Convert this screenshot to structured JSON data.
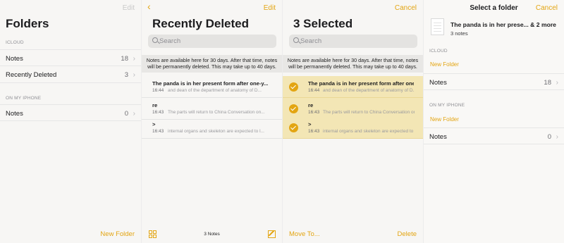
{
  "colors": {
    "accent": "#e3a512",
    "selected_row": "#f3e6b5",
    "background": "#f7f6f4"
  },
  "folders_panel": {
    "edit_label": "Edit",
    "title": "Folders",
    "icloud_header": "ICLOUD",
    "icloud_items": [
      {
        "label": "Notes",
        "count": "18"
      },
      {
        "label": "Recently Deleted",
        "count": "3"
      }
    ],
    "iphone_header": "ON MY IPHONE",
    "iphone_items": [
      {
        "label": "Notes",
        "count": "0"
      }
    ],
    "new_folder_label": "New Folder"
  },
  "deleted_panel": {
    "back_icon": "chevron-left",
    "edit_label": "Edit",
    "title": "Recently Deleted",
    "search_placeholder": "Search",
    "notice": "Notes are available here for 30 days. After that time, notes will be permanently deleted. This may take up to 40 days.",
    "notes": [
      {
        "title": "The panda is in her present form after one-y...",
        "time": "16:44",
        "preview": "and dean of the department of anatomy of D..."
      },
      {
        "title": "re",
        "time": "16:43",
        "preview": "The parts will return to China Conversation on..."
      },
      {
        "title": ">",
        "time": "16:43",
        "preview": "internal organs and skeleton are expected to l..."
      }
    ],
    "footer_count": "3 Notes"
  },
  "selected_panel": {
    "cancel_label": "Cancel",
    "title": "3 Selected",
    "search_placeholder": "Search",
    "notice": "Notes are available here for 30 days. After that time, notes will be permanently deleted. This may take up to 40 days.",
    "notes": [
      {
        "title": "The panda is in her present form after one-y...",
        "time": "16:44",
        "preview": "and dean of the department of anatomy of D..."
      },
      {
        "title": "re",
        "time": "16:43",
        "preview": "The parts will return to China Conversation on..."
      },
      {
        "title": ">",
        "time": "16:43",
        "preview": "internal organs and skeleton are expected to l..."
      }
    ],
    "move_label": "Move To...",
    "delete_label": "Delete"
  },
  "move_panel": {
    "title": "Select a folder",
    "cancel_label": "Cancel",
    "note_title": "The panda is in her prese... & 2 more",
    "note_sub": "3 notes",
    "icloud_header": "ICLOUD",
    "icloud_new_folder": "New Folder",
    "icloud_items": [
      {
        "label": "Notes",
        "count": "18"
      }
    ],
    "iphone_header": "ON MY IPHONE",
    "iphone_new_folder": "New Folder",
    "iphone_items": [
      {
        "label": "Notes",
        "count": "0"
      }
    ]
  }
}
